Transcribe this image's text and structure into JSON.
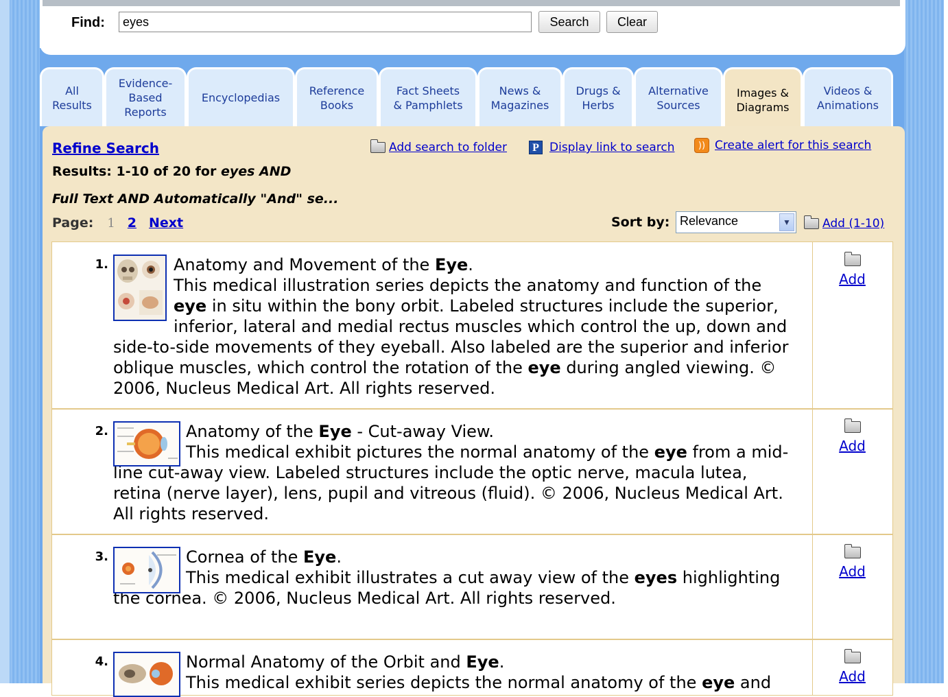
{
  "search": {
    "find_label": "Find:",
    "query_value": "eyes",
    "search_button": "Search",
    "clear_button": "Clear"
  },
  "tabs": [
    {
      "line1": "All",
      "line2": "Results",
      "line3": ""
    },
    {
      "line1": "Evidence-",
      "line2": "Based",
      "line3": "Reports"
    },
    {
      "line1": "Encyclopedias",
      "line2": "",
      "line3": ""
    },
    {
      "line1": "Reference",
      "line2": "Books",
      "line3": ""
    },
    {
      "line1": "Fact Sheets",
      "line2": "& Pamphlets",
      "line3": ""
    },
    {
      "line1": "News &",
      "line2": "Magazines",
      "line3": ""
    },
    {
      "line1": "Drugs &",
      "line2": "Herbs",
      "line3": ""
    },
    {
      "line1": "Alternative",
      "line2": "Sources",
      "line3": ""
    },
    {
      "line1": "Images &",
      "line2": "Diagrams",
      "line3": ""
    },
    {
      "line1": "Videos &",
      "line2": "Animations",
      "line3": ""
    }
  ],
  "active_tab": "Images & Diagrams",
  "toolbar": {
    "refine": "Refine Search",
    "add_folder": "Add search to folder",
    "display_link": "Display link to search",
    "create_alert": "Create alert for this search"
  },
  "summary": {
    "results_prefix": "Results: 1-10 of 20 for ",
    "results_query": "eyes AND",
    "query_line": "Full Text AND Automatically \"And\" se..."
  },
  "pagination": {
    "label": "Page:",
    "current": "1",
    "next_page": "2",
    "next": "Next"
  },
  "sort": {
    "label": "Sort by:",
    "value": "Relevance",
    "add_all": "Add (1-10)"
  },
  "results": [
    {
      "num": "1.",
      "title_pre": "Anatomy and Movement of the ",
      "title_bold": "Eye",
      "title_post": ".",
      "desc": [
        {
          "t": "This medical illustration series depicts the anatomy and function of the ",
          "b": false
        },
        {
          "t": "eye",
          "b": true
        },
        {
          "t": " in situ within the bony orbit. Labeled structures include the superior, inferior, lateral and medial rectus muscles which control the up, down and side-to-side movements of they eyeball. Also labeled are the superior and inferior oblique muscles, which control the rotation of the ",
          "b": false
        },
        {
          "t": "eye",
          "b": true
        },
        {
          "t": " during angled viewing. © 2006, Nucleus Medical Art. All rights reserved.",
          "b": false
        }
      ],
      "add": "Add"
    },
    {
      "num": "2.",
      "title_pre": "Anatomy of the ",
      "title_bold": "Eye",
      "title_post": " - Cut-away View.",
      "desc": [
        {
          "t": "This medical exhibit pictures the normal anatomy of the ",
          "b": false
        },
        {
          "t": "eye",
          "b": true
        },
        {
          "t": " from a mid-line cut-away view. Labeled structures include the optic nerve, macula lutea, retina (nerve layer), lens, pupil and vitreous (fluid). © 2006, Nucleus Medical Art. All rights reserved.",
          "b": false
        }
      ],
      "add": "Add"
    },
    {
      "num": "3.",
      "title_pre": "Cornea of the ",
      "title_bold": "Eye",
      "title_post": ".",
      "desc": [
        {
          "t": "This medical exhibit illustrates a cut away view of the ",
          "b": false
        },
        {
          "t": "eyes",
          "b": true
        },
        {
          "t": " highlighting the cornea. © 2006, Nucleus Medical Art. All rights reserved.",
          "b": false
        }
      ],
      "add": "Add"
    },
    {
      "num": "4.",
      "title_pre": "Normal Anatomy of the Orbit and ",
      "title_bold": "Eye",
      "title_post": ".",
      "desc": [
        {
          "t": "This medical exhibit series depicts the normal anatomy of the ",
          "b": false
        },
        {
          "t": "eye",
          "b": true
        },
        {
          "t": " and",
          "b": false
        }
      ],
      "add": "Add"
    }
  ]
}
